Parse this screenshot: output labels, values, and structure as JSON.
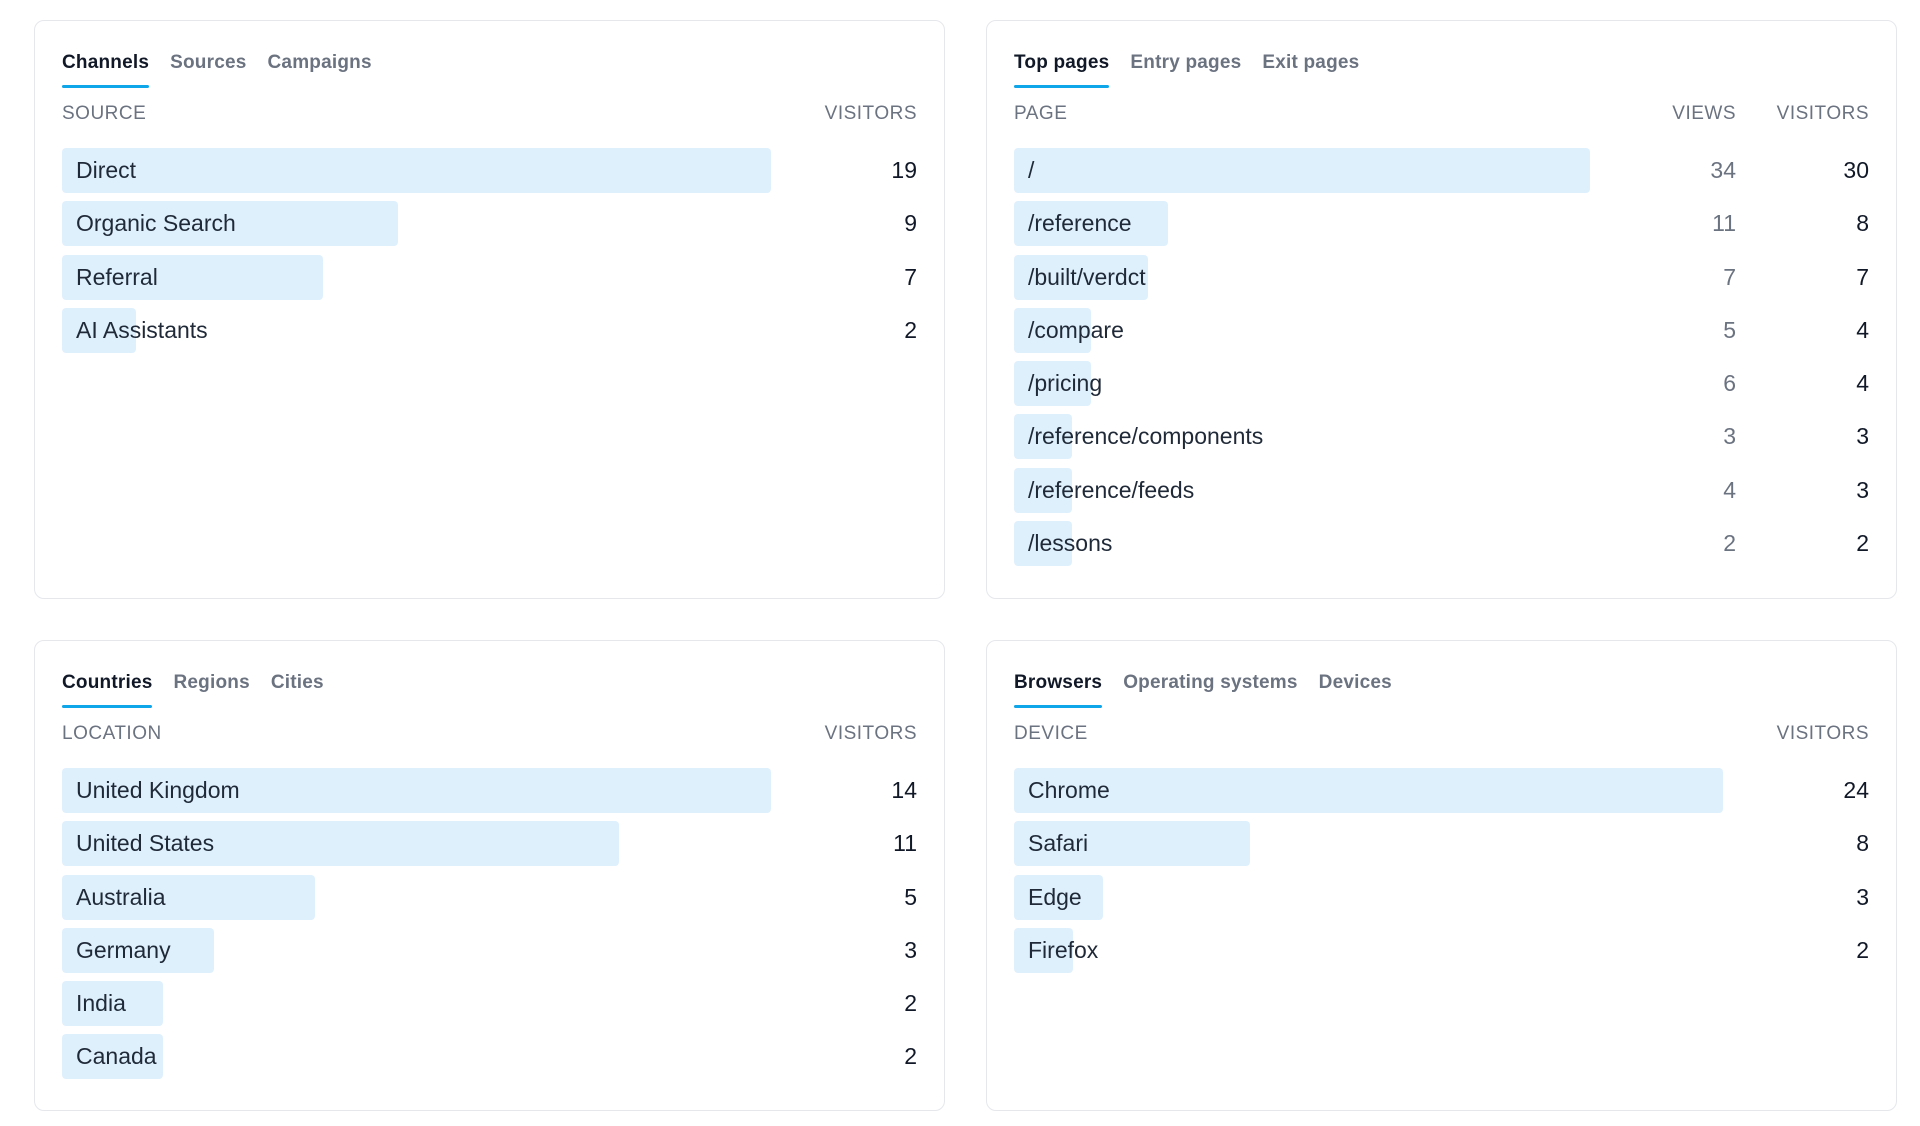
{
  "channels_card": {
    "tabs": [
      "Channels",
      "Sources",
      "Campaigns"
    ],
    "col_source": "SOURCE",
    "col_visitors": "VISITORS",
    "rows": [
      {
        "label": "Direct",
        "visitors": "19",
        "bar_fraction": 1.0
      },
      {
        "label": "Organic Search",
        "visitors": "9",
        "bar_fraction": 0.474
      },
      {
        "label": "Referral",
        "visitors": "7",
        "bar_fraction": 0.368
      },
      {
        "label": "AI Assistants",
        "visitors": "2",
        "bar_fraction": 0.105
      }
    ]
  },
  "pages_card": {
    "tabs": [
      "Top pages",
      "Entry pages",
      "Exit pages"
    ],
    "col_page": "PAGE",
    "col_views": "VIEWS",
    "col_visitors": "VISITORS",
    "rows": [
      {
        "label": "/",
        "views": "34",
        "visitors": "30",
        "bar_fraction": 1.0
      },
      {
        "label": "/reference",
        "views": "11",
        "visitors": "8",
        "bar_fraction": 0.267
      },
      {
        "label": "/built/verdct",
        "views": "7",
        "visitors": "7",
        "bar_fraction": 0.233
      },
      {
        "label": "/compare",
        "views": "5",
        "visitors": "4",
        "bar_fraction": 0.133
      },
      {
        "label": "/pricing",
        "views": "6",
        "visitors": "4",
        "bar_fraction": 0.133
      },
      {
        "label": "/reference/components",
        "views": "3",
        "visitors": "3",
        "bar_fraction": 0.1
      },
      {
        "label": "/reference/feeds",
        "views": "4",
        "visitors": "3",
        "bar_fraction": 0.1
      },
      {
        "label": "/lessons",
        "views": "2",
        "visitors": "2",
        "bar_fraction": 0.067
      }
    ]
  },
  "countries_card": {
    "tabs": [
      "Countries",
      "Regions",
      "Cities"
    ],
    "col_location": "LOCATION",
    "col_visitors": "VISITORS",
    "rows": [
      {
        "label": "United Kingdom",
        "visitors": "14",
        "bar_fraction": 1.0
      },
      {
        "label": "United States",
        "visitors": "11",
        "bar_fraction": 0.786
      },
      {
        "label": "Australia",
        "visitors": "5",
        "bar_fraction": 0.357
      },
      {
        "label": "Germany",
        "visitors": "3",
        "bar_fraction": 0.214
      },
      {
        "label": "India",
        "visitors": "2",
        "bar_fraction": 0.143
      },
      {
        "label": "Canada",
        "visitors": "2",
        "bar_fraction": 0.143
      }
    ]
  },
  "browsers_card": {
    "tabs": [
      "Browsers",
      "Operating systems",
      "Devices"
    ],
    "col_device": "DEVICE",
    "col_visitors": "VISITORS",
    "rows": [
      {
        "label": "Chrome",
        "visitors": "24",
        "bar_fraction": 1.0
      },
      {
        "label": "Safari",
        "visitors": "8",
        "bar_fraction": 0.333
      },
      {
        "label": "Edge",
        "visitors": "3",
        "bar_fraction": 0.125
      },
      {
        "label": "Firefox",
        "visitors": "2",
        "bar_fraction": 0.083
      }
    ]
  },
  "colors": {
    "bar": "#dff0fd",
    "tab_underline": "#0ea5e9",
    "muted_text": "#6b7280",
    "border": "#e5e7eb"
  }
}
